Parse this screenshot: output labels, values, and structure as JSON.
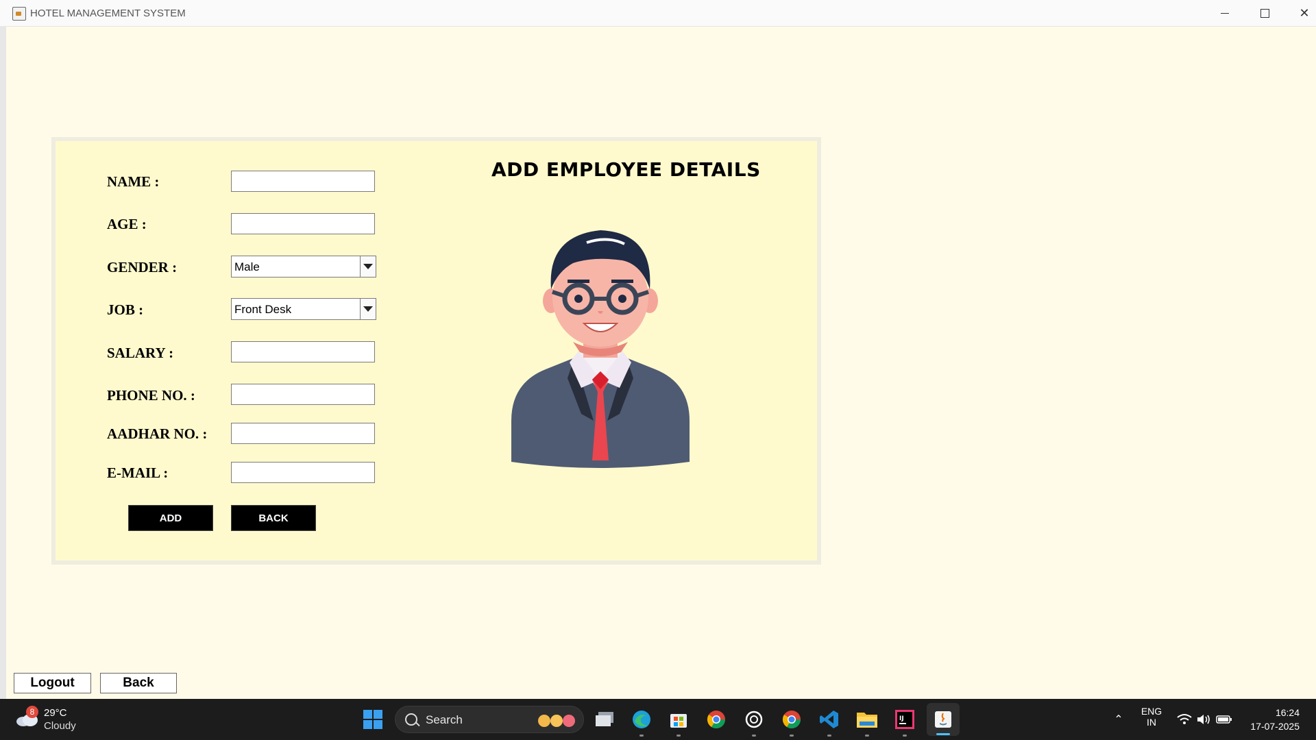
{
  "window": {
    "title": "HOTEL MANAGEMENT SYSTEM"
  },
  "form": {
    "heading": "ADD EMPLOYEE DETAILS",
    "fields": {
      "name": {
        "label": "NAME :",
        "value": ""
      },
      "age": {
        "label": "AGE :",
        "value": ""
      },
      "gender": {
        "label": "GENDER :",
        "selected": "Male"
      },
      "job": {
        "label": "JOB :",
        "selected": "Front Desk"
      },
      "salary": {
        "label": "SALARY :",
        "value": ""
      },
      "phone": {
        "label": "PHONE NO. :",
        "value": ""
      },
      "aadhar": {
        "label": "AADHAR NO. :",
        "value": ""
      },
      "email": {
        "label": "E-MAIL :",
        "value": ""
      }
    },
    "buttons": {
      "add": "ADD",
      "back": "BACK"
    }
  },
  "footer": {
    "logout": "Logout",
    "back": "Back"
  },
  "taskbar": {
    "weather": {
      "temp": "29°C",
      "condition": "Cloudy",
      "badge": "8"
    },
    "search_label": "Search",
    "language": "ENG",
    "region": "IN",
    "time": "16:24",
    "date": "17-07-2025"
  },
  "colors": {
    "background": "#fffbe8",
    "panel": "#fffacd",
    "button_black": "#000000",
    "taskbar": "#1c1c1c"
  }
}
